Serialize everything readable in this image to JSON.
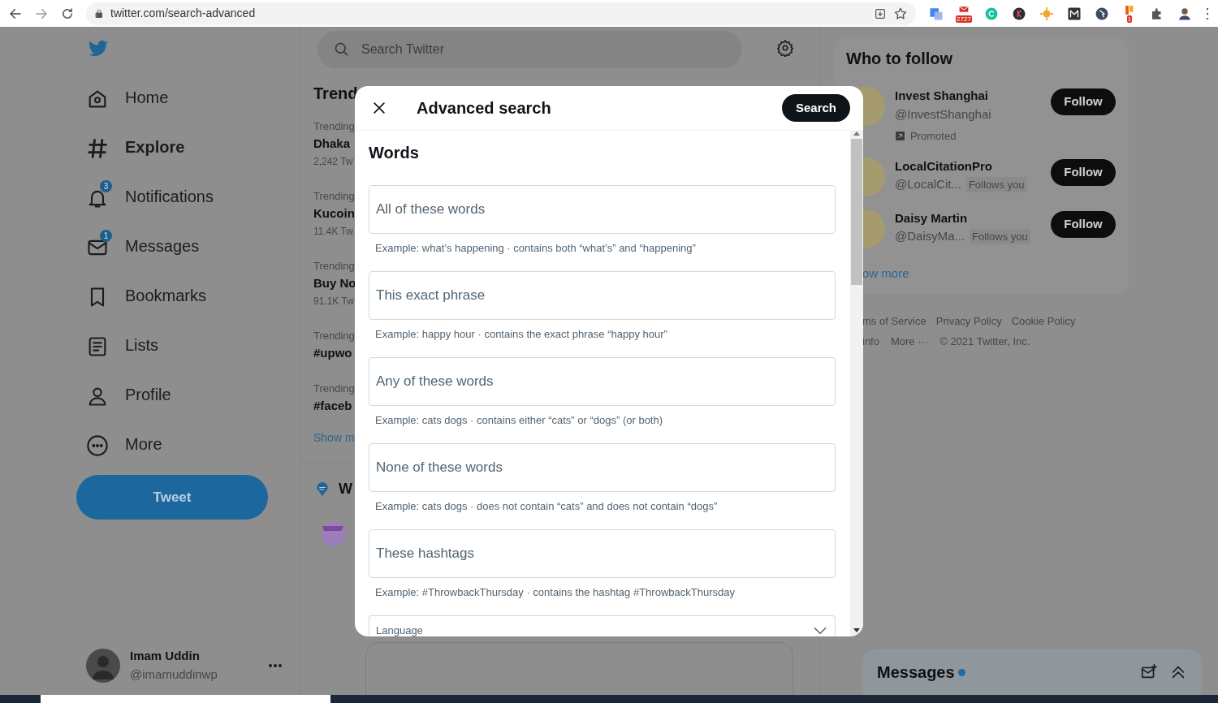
{
  "browser": {
    "url": "twitter.com/search-advanced",
    "extensions": [
      {
        "kind": "translate"
      },
      {
        "kind": "mail",
        "badge": "2727"
      },
      {
        "kind": "grammar"
      },
      {
        "kind": "dark-k"
      },
      {
        "kind": "sun"
      },
      {
        "kind": "m"
      },
      {
        "kind": "pointer"
      },
      {
        "kind": "office",
        "badge": "1"
      },
      {
        "kind": "puzzle"
      },
      {
        "kind": "profile"
      }
    ]
  },
  "nav": [
    {
      "kind": "home",
      "label": "Home",
      "selected": false
    },
    {
      "kind": "explore",
      "label": "Explore",
      "selected": true
    },
    {
      "kind": "notifications",
      "label": "Notifications",
      "selected": false,
      "badge": "3"
    },
    {
      "kind": "messages",
      "label": "Messages",
      "selected": false,
      "badge": "1"
    },
    {
      "kind": "bookmarks",
      "label": "Bookmarks",
      "selected": false
    },
    {
      "kind": "lists",
      "label": "Lists",
      "selected": false
    },
    {
      "kind": "profile",
      "label": "Profile",
      "selected": false
    },
    {
      "kind": "more",
      "label": "More",
      "selected": false
    }
  ],
  "tweet_button": "Tweet",
  "account": {
    "name": "Imam Uddin",
    "handle": "@imamuddinwp"
  },
  "search": {
    "placeholder": "Search Twitter"
  },
  "trends": {
    "title": "Trend",
    "items": [
      {
        "context": "Trending",
        "name": "Dhaka",
        "count": "2,242 Tw"
      },
      {
        "context": "Trending",
        "name": "Kucoin",
        "count": "11.4K Tw"
      },
      {
        "context": "Trending",
        "name": "Buy No",
        "count": "91.1K Tw"
      },
      {
        "context": "Trending",
        "name": "#upwo"
      },
      {
        "context": "Trending",
        "name": "#faceb"
      }
    ],
    "show_more": "Show m"
  },
  "section_2": {
    "title": "W"
  },
  "who_to_follow": {
    "title": "Who to follow",
    "accounts": [
      {
        "name": "Invest Shanghai",
        "handle": "@InvestShanghai",
        "promoted": "Promoted",
        "button": "Follow"
      },
      {
        "name": "LocalCitationPro",
        "handle": "@LocalCit...",
        "follows_you": "Follows you",
        "button": "Follow"
      },
      {
        "name": "Daisy Martin",
        "handle": "@DaisyMa...",
        "follows_you": "Follows you",
        "button": "Follow"
      }
    ],
    "show_more": "ow more"
  },
  "footer": {
    "links_row_1": [
      "ms of Service",
      "Privacy Policy",
      "Cookie Policy"
    ],
    "links_row_2": [
      "info",
      "More ···"
    ],
    "copyright": "© 2021 Twitter, Inc."
  },
  "modal": {
    "title": "Advanced search",
    "action": "Search",
    "section": "Words",
    "fields": [
      {
        "placeholder": "All of these words",
        "hint": "Example: what’s happening · contains both “what’s” and “happening”"
      },
      {
        "placeholder": "This exact phrase",
        "hint": "Example: happy hour · contains the exact phrase “happy hour”"
      },
      {
        "placeholder": "Any of these words",
        "hint": "Example: cats dogs · contains either “cats” or “dogs” (or both)"
      },
      {
        "placeholder": "None of these words",
        "hint": "Example: cats dogs · does not contain “cats” and does not contain “dogs”"
      },
      {
        "placeholder": "These hashtags",
        "hint": "Example: #ThrowbackThursday · contains the hashtag #ThrowbackThursday"
      }
    ],
    "select": {
      "label": "Language"
    }
  },
  "messages_dock": {
    "title": "Messages",
    "unread": true
  }
}
